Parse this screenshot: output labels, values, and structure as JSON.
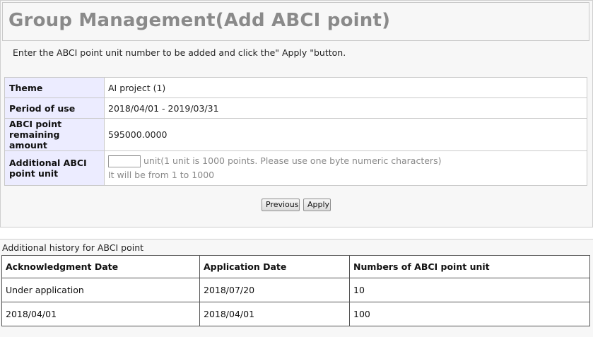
{
  "page": {
    "title": "Group Management(Add ABCI point)",
    "instruction": "Enter the ABCI point unit number to be added and click the\" Apply \"button."
  },
  "form": {
    "theme_label": "Theme",
    "theme_value": "AI project (1)",
    "period_label": "Period of use",
    "period_value": "2018/04/01 - 2019/03/31",
    "remaining_label_line1": "ABCI point",
    "remaining_label_line2": "remaining amount",
    "remaining_value": "595000.0000",
    "additional_label_line1": "Additional ABCI",
    "additional_label_line2": "point unit",
    "additional_input_value": "",
    "unit_note": "unit(1 unit is 1000 points. Please use one byte numeric characters)",
    "range_hint": "It will be from 1 to 1000"
  },
  "buttons": {
    "previous": "Previous",
    "apply": "Apply"
  },
  "history": {
    "caption": "Additional history for ABCI point",
    "headers": [
      "Acknowledgment Date",
      "Application Date",
      "Numbers of ABCI point unit"
    ],
    "rows": [
      [
        "Under application",
        "2018/07/20",
        "10"
      ],
      [
        "2018/04/01",
        "2018/04/01",
        "100"
      ]
    ]
  },
  "colors": {
    "title_grey": "#8a8a8a",
    "label_cell_bg": "#ececff",
    "panel_bg": "#f7f7f7"
  }
}
